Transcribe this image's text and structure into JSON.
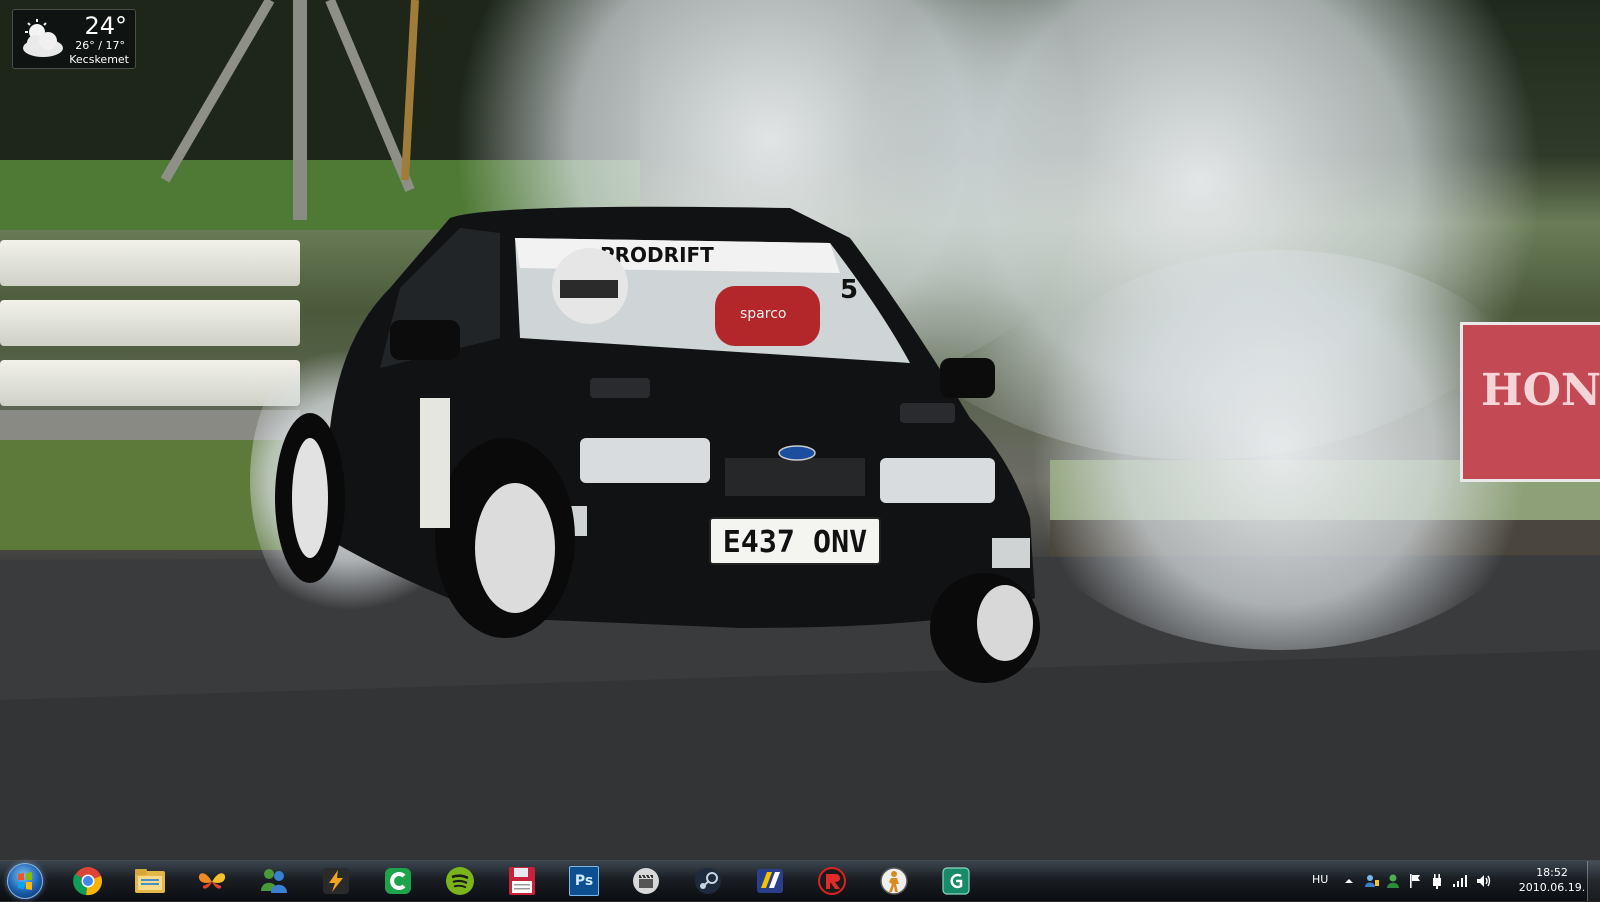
{
  "weather_widget": {
    "temperature": "24°",
    "range": "26° / 17°",
    "city": "Kecskemet",
    "icon": "partly-cloudy-icon"
  },
  "wallpaper": {
    "license_plate": "E437 ONV",
    "windshield_banner": "PRODRIFT",
    "car_number": "5",
    "sign_text": "HON",
    "seat_text": "sparco"
  },
  "taskbar": {
    "start_icon": "windows-orb-icon",
    "pinned": [
      {
        "name": "chrome-icon"
      },
      {
        "name": "file-explorer-icon"
      },
      {
        "name": "messenger-butterfly-icon"
      },
      {
        "name": "msn-messenger-icon"
      },
      {
        "name": "winamp-icon"
      },
      {
        "name": "green-c-app-icon"
      },
      {
        "name": "spotify-icon"
      },
      {
        "name": "save-disk-icon"
      },
      {
        "name": "photoshop-icon"
      },
      {
        "name": "clapper-icon"
      },
      {
        "name": "steam-icon"
      },
      {
        "name": "speed-app-icon"
      },
      {
        "name": "red-r-app-icon"
      },
      {
        "name": "counter-strike-icon"
      },
      {
        "name": "spiral-app-icon"
      }
    ],
    "photoshop_label": "Ps",
    "tray": {
      "language": "HU",
      "time": "18:52",
      "date": "2010.06.19."
    }
  },
  "colors": {
    "taskbar": "#1a1f26",
    "accent": "#3b8fd6"
  }
}
